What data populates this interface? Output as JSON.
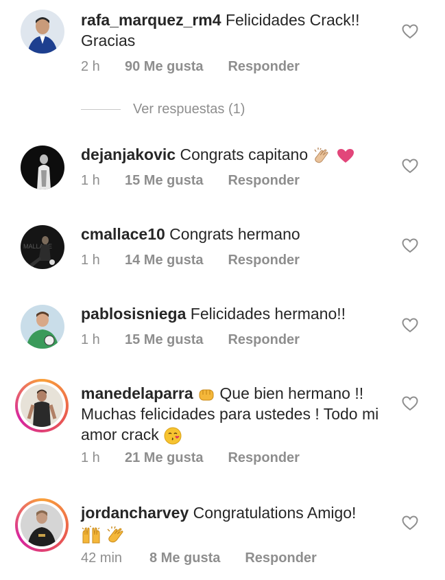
{
  "comments": [
    {
      "username": "rafa_marquez_rm4",
      "text": "Felicidades Crack!! Gracias",
      "time": "2 h",
      "likes": "90 Me gusta",
      "reply": "Responder"
    },
    {
      "username": "dejanjakovic",
      "text": "Congrats capitano",
      "emojis": [
        "clapping-hands-emoji",
        "heart-emoji"
      ],
      "time": "1 h",
      "likes": "15 Me gusta",
      "reply": "Responder"
    },
    {
      "username": "cmallace10",
      "text": "Congrats hermano",
      "time": "1 h",
      "likes": "14 Me gusta",
      "reply": "Responder"
    },
    {
      "username": "pablosisniega",
      "text": "Felicidades hermano!!",
      "time": "1 h",
      "likes": "15 Me gusta",
      "reply": "Responder"
    },
    {
      "username": "manedelaparra",
      "text_before": "Que bien hermano !! Muchas felicidades para ustedes ! Todo mi amor crack",
      "emojis": [
        "fist-emoji",
        "kissing-face-emoji"
      ],
      "time": "1 h",
      "likes": "21 Me gusta",
      "reply": "Responder",
      "has_story": true
    },
    {
      "username": "jordancharvey",
      "text": "Congratulations Amigo!",
      "emojis": [
        "raised-hands-emoji",
        "clapping-hands-emoji"
      ],
      "time": "42 min",
      "likes": "8 Me gusta",
      "reply": "Responder",
      "has_story": true
    }
  ],
  "view_replies": "Ver respuestas (1)",
  "colors": {
    "text": "#262626",
    "meta": "#8e8e8e",
    "story_ring": [
      "#f9a13a",
      "#e95950",
      "#d6249f"
    ]
  }
}
